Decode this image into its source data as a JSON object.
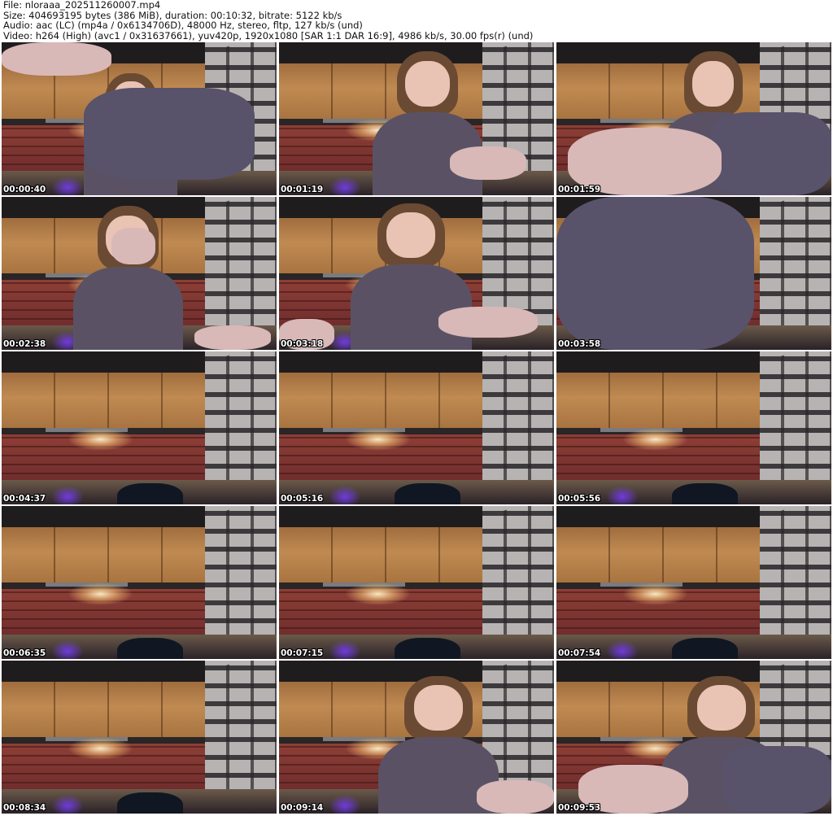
{
  "header": {
    "file": "File: nloraaa_202511260007.mp4",
    "size": "Size: 404693195 bytes (386 MiB), duration: 00:10:32, bitrate: 5122 kb/s",
    "audio": "Audio: aac (LC) (mp4a / 0x6134706D), 48000 Hz, stereo, fltp, 127 kb/s (und)",
    "video": "Video: h264 (High) (avc1 / 0x31637661), yuv420p, 1920x1080 [SAR 1:1 DAR 16:9], 4986 kb/s, 30.00 fps(r) (und)"
  },
  "thumbnails": [
    {
      "timestamp": "00:00:40",
      "scene": "arm-raised"
    },
    {
      "timestamp": "00:01:19",
      "scene": "person-cigarette"
    },
    {
      "timestamp": "00:01:59",
      "scene": "hand-closeup"
    },
    {
      "timestamp": "00:02:38",
      "scene": "hand-to-mouth"
    },
    {
      "timestamp": "00:03:18",
      "scene": "person-reaching"
    },
    {
      "timestamp": "00:03:58",
      "scene": "sleeve-blocking"
    },
    {
      "timestamp": "00:04:37",
      "scene": "empty-room"
    },
    {
      "timestamp": "00:05:16",
      "scene": "empty-room"
    },
    {
      "timestamp": "00:05:56",
      "scene": "empty-room"
    },
    {
      "timestamp": "00:06:35",
      "scene": "empty-room"
    },
    {
      "timestamp": "00:07:15",
      "scene": "empty-room"
    },
    {
      "timestamp": "00:07:54",
      "scene": "empty-room"
    },
    {
      "timestamp": "00:08:34",
      "scene": "empty-room"
    },
    {
      "timestamp": "00:09:14",
      "scene": "person-right"
    },
    {
      "timestamp": "00:09:53",
      "scene": "person-fist"
    }
  ]
}
